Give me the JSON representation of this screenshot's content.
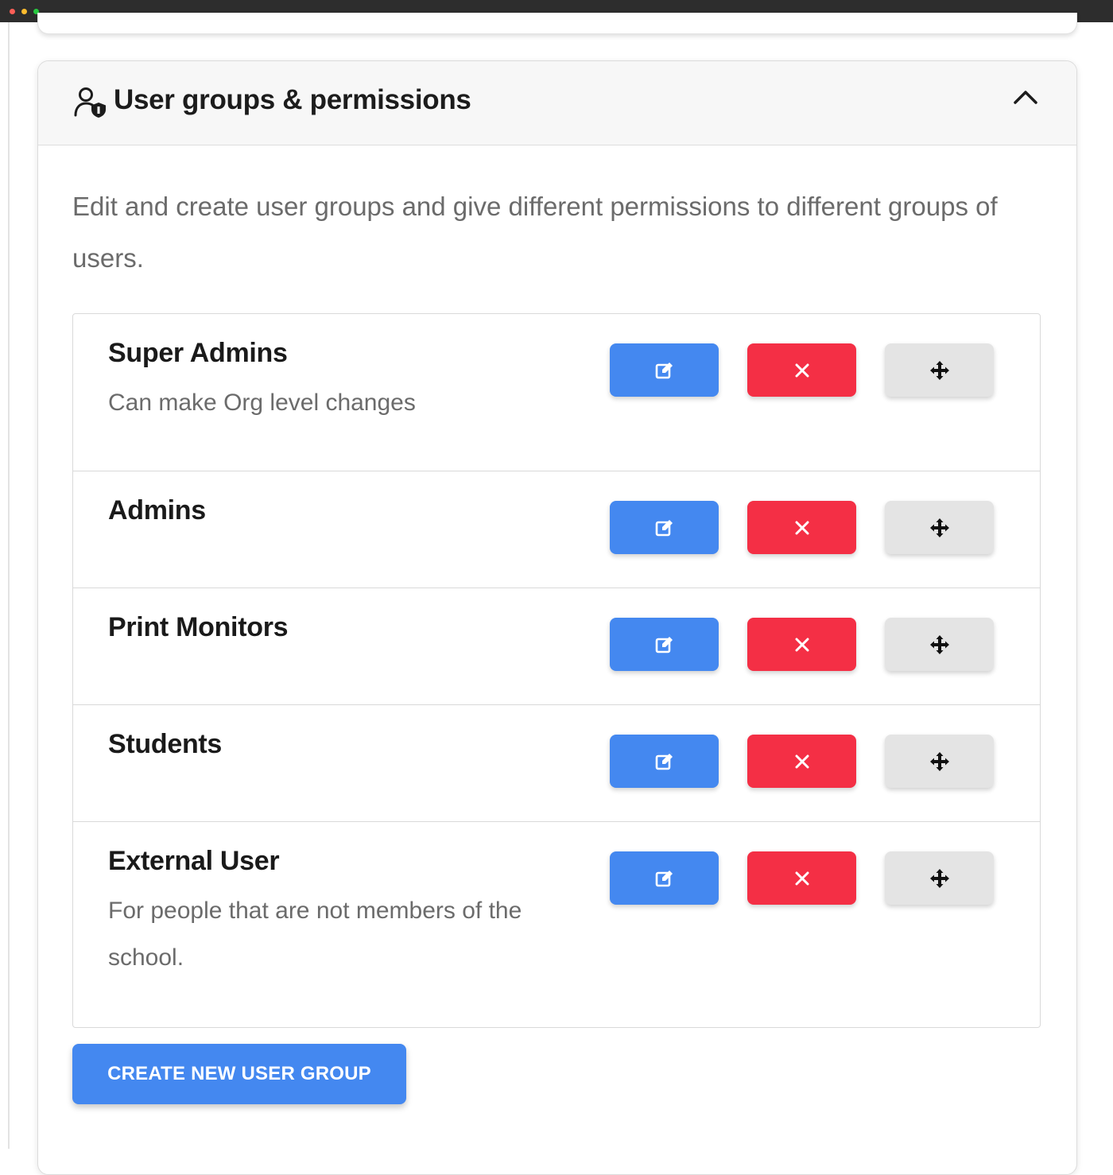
{
  "window": {
    "controls": [
      "close-dot",
      "minimize-dot",
      "maximize-dot"
    ]
  },
  "section": {
    "title": "User groups & permissions",
    "icon": "user-shield-icon",
    "collapse_icon": "chevron-up-icon",
    "description": "Edit and create user groups and give different permissions to different groups of users."
  },
  "groups": [
    {
      "name": "Super Admins",
      "description": "Can make Org level changes"
    },
    {
      "name": "Admins",
      "description": ""
    },
    {
      "name": "Print Monitors",
      "description": ""
    },
    {
      "name": "Students",
      "description": ""
    },
    {
      "name": "External User",
      "description": "For people that are not members of the school."
    }
  ],
  "row_actions": {
    "edit_icon": "edit-icon",
    "delete_icon": "close-icon",
    "move_icon": "move-icon"
  },
  "create_button": {
    "label": "CREATE NEW USER GROUP"
  },
  "colors": {
    "primary": "#4488f0",
    "danger": "#f42f45",
    "neutral": "#e4e4e4"
  }
}
